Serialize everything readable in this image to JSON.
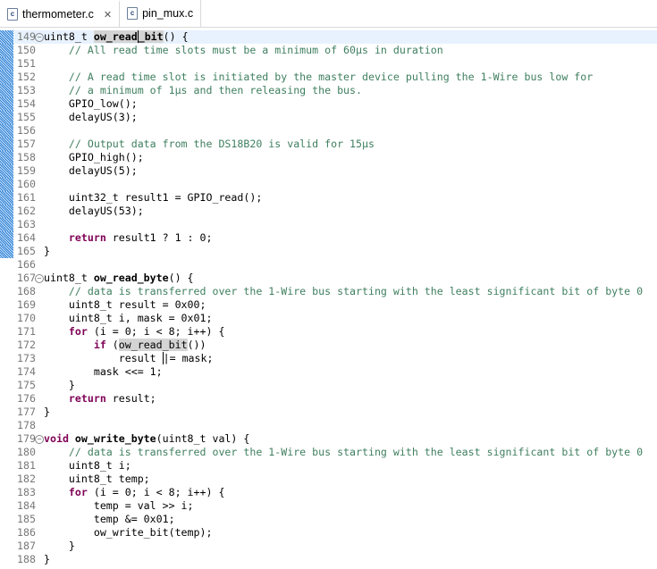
{
  "tabs": [
    {
      "label": "thermometer.c",
      "icon": "c-file-icon",
      "active": true,
      "close": "✕"
    },
    {
      "label": "pin_mux.c",
      "icon": "c-file-icon",
      "active": false
    }
  ],
  "icon_letter": "c",
  "editor": {
    "lines": [
      {
        "n": "149",
        "fold": true,
        "chg": true,
        "cur": true,
        "t": [
          [
            "",
            "uint8_t "
          ],
          [
            "bh",
            "ow_read"
          ],
          [
            "bhc",
            "_bit"
          ],
          [
            "",
            "() {"
          ]
        ]
      },
      {
        "n": "150",
        "chg": true,
        "t": [
          [
            "",
            "    "
          ],
          [
            "cm",
            "// All read time slots must be a minimum of 60µs in duration"
          ]
        ]
      },
      {
        "n": "151",
        "chg": true,
        "t": []
      },
      {
        "n": "152",
        "chg": true,
        "t": [
          [
            "",
            "    "
          ],
          [
            "cm",
            "// A read time slot is initiated by the master device pulling the 1-Wire bus low for"
          ]
        ]
      },
      {
        "n": "153",
        "chg": true,
        "t": [
          [
            "",
            "    "
          ],
          [
            "cm",
            "// a minimum of 1µs and then releasing the bus."
          ]
        ]
      },
      {
        "n": "154",
        "chg": true,
        "t": [
          [
            "",
            "    GPIO_low();"
          ]
        ]
      },
      {
        "n": "155",
        "chg": true,
        "t": [
          [
            "",
            "    delayUS(3);"
          ]
        ]
      },
      {
        "n": "156",
        "chg": true,
        "t": []
      },
      {
        "n": "157",
        "chg": true,
        "t": [
          [
            "",
            "    "
          ],
          [
            "cm",
            "// Output data from the DS18B20 is valid for 15µs"
          ]
        ]
      },
      {
        "n": "158",
        "chg": true,
        "t": [
          [
            "",
            "    GPIO_high();"
          ]
        ]
      },
      {
        "n": "159",
        "chg": true,
        "t": [
          [
            "",
            "    delayUS(5);"
          ]
        ]
      },
      {
        "n": "160",
        "chg": true,
        "t": []
      },
      {
        "n": "161",
        "chg": true,
        "t": [
          [
            "",
            "    uint32_t result1 = GPIO_read();"
          ]
        ]
      },
      {
        "n": "162",
        "chg": true,
        "t": [
          [
            "",
            "    delayUS(53);"
          ]
        ]
      },
      {
        "n": "163",
        "chg": true,
        "t": []
      },
      {
        "n": "164",
        "chg": true,
        "t": [
          [
            "",
            "    "
          ],
          [
            "kw",
            "return"
          ],
          [
            "",
            " result1 ? 1 : 0;"
          ]
        ]
      },
      {
        "n": "165",
        "chg": true,
        "t": [
          [
            "",
            "}"
          ]
        ]
      },
      {
        "n": "166",
        "t": []
      },
      {
        "n": "167",
        "fold": true,
        "t": [
          [
            "",
            "uint8_t "
          ],
          [
            "b",
            "ow_read_byte"
          ],
          [
            "",
            "() {"
          ]
        ]
      },
      {
        "n": "168",
        "t": [
          [
            "",
            "    "
          ],
          [
            "cm",
            "// data is transferred over the 1-Wire bus starting with the least significant bit of byte 0"
          ]
        ]
      },
      {
        "n": "169",
        "t": [
          [
            "",
            "    uint8_t result = 0x00;"
          ]
        ]
      },
      {
        "n": "170",
        "t": [
          [
            "",
            "    uint8_t i, mask = 0x01;"
          ]
        ]
      },
      {
        "n": "171",
        "t": [
          [
            "",
            "    "
          ],
          [
            "kw",
            "for"
          ],
          [
            "",
            " (i = 0; i < 8; i++) {"
          ]
        ]
      },
      {
        "n": "172",
        "t": [
          [
            "",
            "        "
          ],
          [
            "kw",
            "if"
          ],
          [
            "",
            " ("
          ],
          [
            "h",
            "ow_read_bit"
          ],
          [
            "",
            "())"
          ]
        ]
      },
      {
        "n": "173",
        "t": [
          [
            "",
            "            result "
          ],
          [
            "c",
            "|"
          ],
          [
            "",
            "= mask;"
          ]
        ]
      },
      {
        "n": "174",
        "t": [
          [
            "",
            "        mask <<= 1;"
          ]
        ]
      },
      {
        "n": "175",
        "t": [
          [
            "",
            "    }"
          ]
        ]
      },
      {
        "n": "176",
        "t": [
          [
            "",
            "    "
          ],
          [
            "kw",
            "return"
          ],
          [
            "",
            " result;"
          ]
        ]
      },
      {
        "n": "177",
        "t": [
          [
            "",
            "}"
          ]
        ]
      },
      {
        "n": "178",
        "t": []
      },
      {
        "n": "179",
        "fold": true,
        "t": [
          [
            "kw",
            "void"
          ],
          [
            "",
            " "
          ],
          [
            "b",
            "ow_write_byte"
          ],
          [
            "",
            "(uint8_t val) {"
          ]
        ]
      },
      {
        "n": "180",
        "t": [
          [
            "",
            "    "
          ],
          [
            "cm",
            "// data is transferred over the 1-Wire bus starting with the least significant bit of byte 0"
          ]
        ]
      },
      {
        "n": "181",
        "t": [
          [
            "",
            "    uint8_t i;"
          ]
        ]
      },
      {
        "n": "182",
        "t": [
          [
            "",
            "    uint8_t temp;"
          ]
        ]
      },
      {
        "n": "183",
        "t": [
          [
            "",
            "    "
          ],
          [
            "kw",
            "for"
          ],
          [
            "",
            " (i = 0; i < 8; i++) {"
          ]
        ]
      },
      {
        "n": "184",
        "t": [
          [
            "",
            "        temp = val >> i;"
          ]
        ]
      },
      {
        "n": "185",
        "t": [
          [
            "",
            "        temp &= 0x01;"
          ]
        ]
      },
      {
        "n": "186",
        "t": [
          [
            "",
            "        ow_write_bit(temp);"
          ]
        ]
      },
      {
        "n": "187",
        "t": [
          [
            "",
            "    }"
          ]
        ]
      },
      {
        "n": "188",
        "t": [
          [
            "",
            "}"
          ]
        ]
      }
    ]
  }
}
